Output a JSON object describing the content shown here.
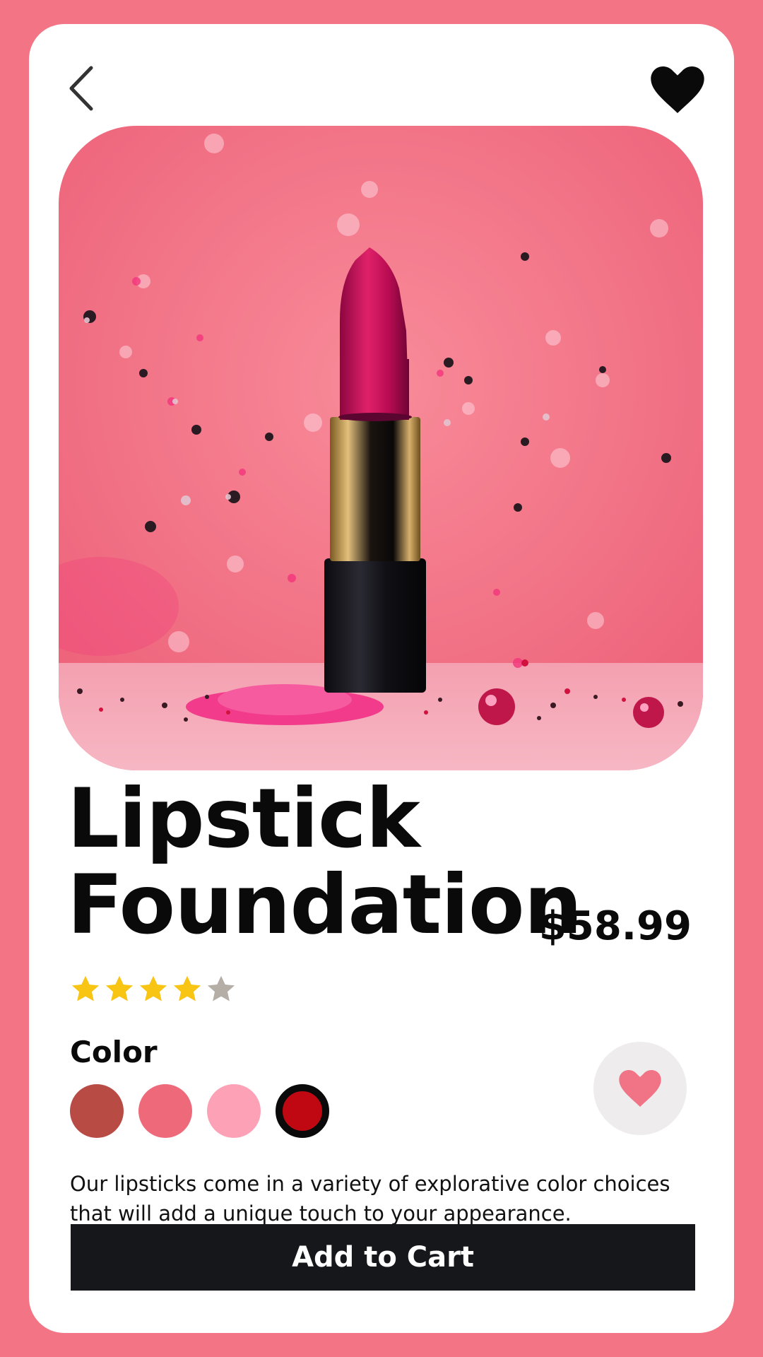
{
  "product": {
    "title_line1": "Lipstick",
    "title_line2": "Foundation",
    "price": "$58.99",
    "rating": 4,
    "rating_max": 5,
    "description": "Our lipsticks come in a variety of explorative color choices that will add a unique touch to your appearance."
  },
  "color_section": {
    "label": "Color",
    "swatches": [
      "#b94b45",
      "#ee6a7b",
      "#fda2b6",
      "#c00812"
    ],
    "selected_index": 3
  },
  "actions": {
    "add_to_cart": "Add to Cart"
  },
  "icons": {
    "back": "chevron-left-icon",
    "favorite_top": "heart-icon",
    "like": "heart-icon"
  },
  "colors": {
    "background": "#f37485",
    "card": "#ffffff",
    "star_filled": "#f8c515",
    "star_empty": "#b4aea6",
    "like_heart": "#f07386",
    "button": "#16171b"
  }
}
